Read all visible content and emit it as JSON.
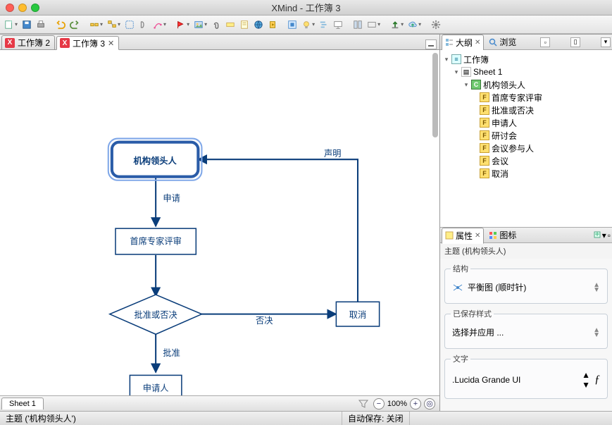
{
  "window": {
    "title": "XMind - 工作簿 3"
  },
  "tabs": [
    {
      "label": "工作簿 2",
      "active": false
    },
    {
      "label": "工作簿 3",
      "active": true
    }
  ],
  "sheet_tab": "Sheet 1",
  "zoom": {
    "value": "100%"
  },
  "diagram": {
    "nodes": {
      "head": "机构领头人",
      "review": "首席专家评审",
      "decision": "批准或否决",
      "applicant": "申请人",
      "cancel": "取消"
    },
    "edges": {
      "apply": "申请",
      "reject": "否决",
      "approve": "批准",
      "declare": "声明"
    }
  },
  "outline": {
    "tabs": {
      "outline": "大纲",
      "browse": "浏览"
    },
    "root": "工作簿",
    "sheet": "Sheet 1",
    "central": "机构领头人",
    "items": [
      "首席专家评审",
      "批准或否决",
      "申请人",
      "研讨会",
      "会议参与人",
      "会议",
      "取消"
    ]
  },
  "properties": {
    "tabs": {
      "props": "属性",
      "icons": "图标"
    },
    "subject_label": "主题 (机构领头人)",
    "structure": {
      "legend": "结构",
      "value": "平衡图 (顺时针)"
    },
    "saved_style": {
      "legend": "已保存样式",
      "value": "选择并应用 ..."
    },
    "font": {
      "legend": "文字",
      "value": ".Lucida Grande UI"
    }
  },
  "status": {
    "subject": "主题 ('机构领头人')",
    "autosave": "自动保存: 关闭"
  }
}
